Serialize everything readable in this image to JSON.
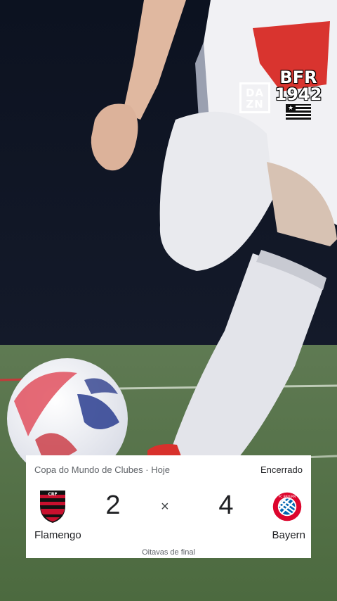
{
  "overlay": {
    "dazn_top": "DA",
    "dazn_bottom": "ZN",
    "bfr_line1": "BFR",
    "bfr_line2": "1942"
  },
  "match": {
    "competition": "Copa do Mundo de Clubes · Hoje",
    "status": "Encerrado",
    "home_team": "Flamengo",
    "home_score": "2",
    "separator": "×",
    "away_score": "4",
    "away_team": "Bayern",
    "round": "Oitavas de final"
  },
  "colors": {
    "flamengo_red": "#c8102e",
    "flamengo_black": "#111111",
    "bayern_red": "#dc052d",
    "bayern_blue": "#0066b2"
  },
  "icons": {
    "home_logo": "flamengo-crest-icon",
    "away_logo": "bayern-crest-icon"
  }
}
